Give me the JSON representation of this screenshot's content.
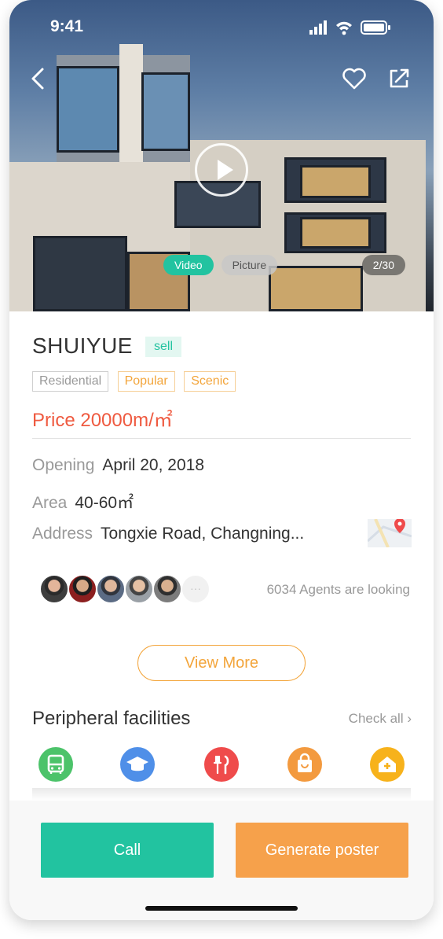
{
  "status": {
    "time": "9:41"
  },
  "hero": {
    "tabs": [
      {
        "label": "Video",
        "active": true
      },
      {
        "label": "Picture",
        "active": false
      }
    ],
    "counter": "2/30"
  },
  "property": {
    "title": "SHUIYUE",
    "badge": "sell",
    "tags": [
      "Residential",
      "Popular",
      "Scenic"
    ],
    "price": "Price 20000m/㎡",
    "opening_label": "Opening",
    "opening_value": "April 20, 2018",
    "area_label": "Area",
    "area_value": "40-60㎡",
    "address_label": "Address",
    "address_value": "Tongxie Road, Changning..."
  },
  "agents": {
    "text": "6034 Agents are looking"
  },
  "view_more": "View More",
  "facilities": {
    "title": "Peripheral facilities",
    "check_all": "Check all",
    "icons": [
      {
        "name": "bus-icon",
        "color": "#4cc36a"
      },
      {
        "name": "graduation-cap-icon",
        "color": "#4f8fe8"
      },
      {
        "name": "restaurant-icon",
        "color": "#ef4b4b"
      },
      {
        "name": "shopping-bag-icon",
        "color": "#f39a3f"
      },
      {
        "name": "hospital-icon",
        "color": "#f7b21b"
      }
    ]
  },
  "actions": {
    "call": "Call",
    "poster": "Generate poster"
  },
  "colors": {
    "accent": "#22c3a0",
    "orange": "#f3a53b",
    "price": "#ef5a40",
    "poster_btn": "#f6a14b"
  }
}
